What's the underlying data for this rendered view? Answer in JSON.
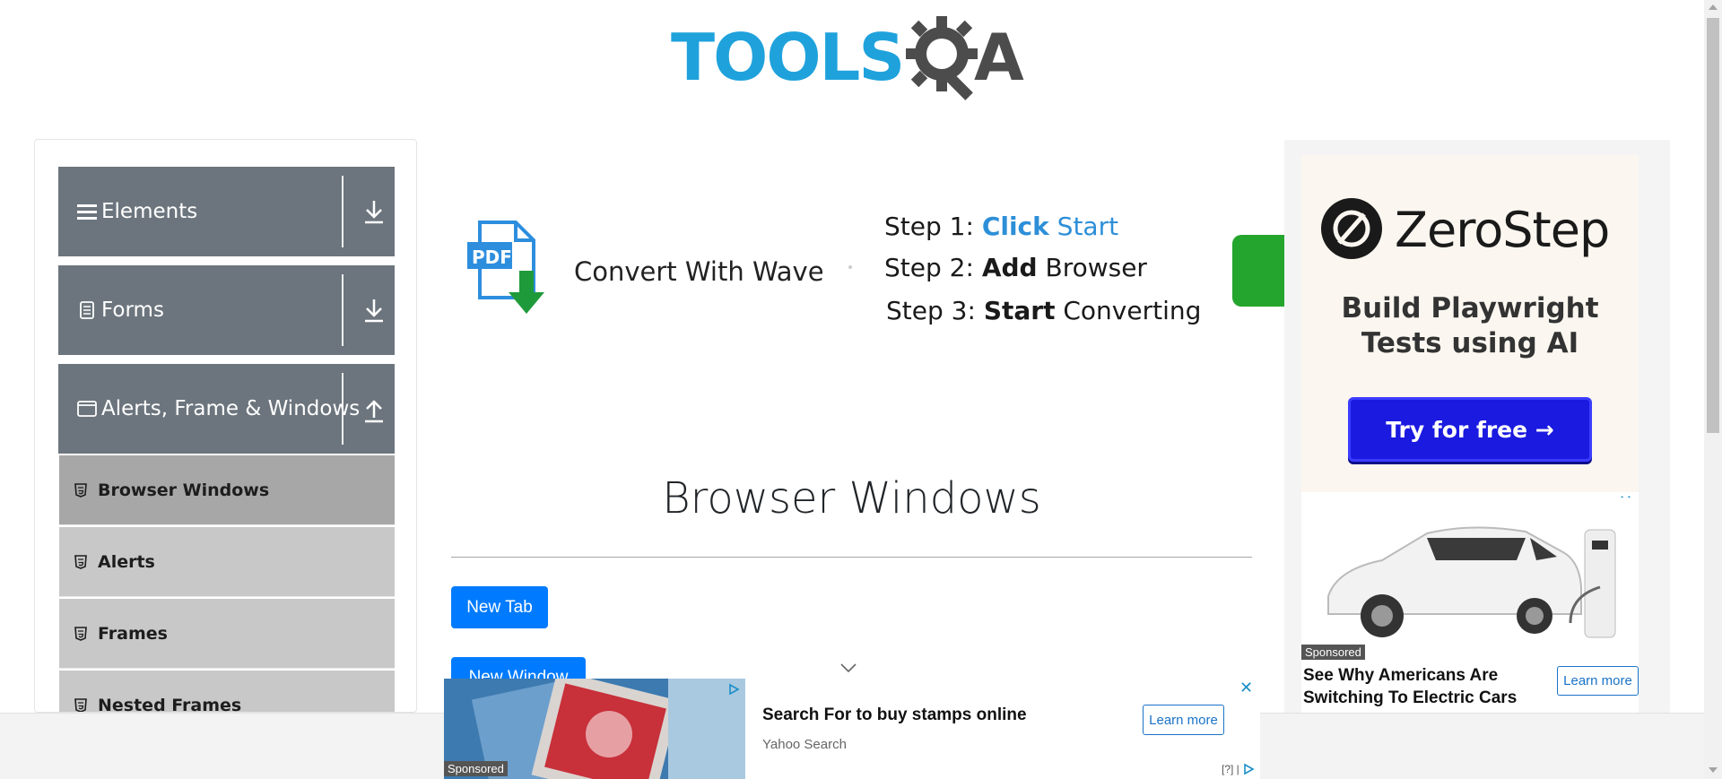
{
  "logo": {
    "text": "TOOLS",
    "suffix": "A"
  },
  "sidebar": {
    "groups": [
      {
        "label": "Elements",
        "icon": "hamburger-icon",
        "arrow": "download-arrow-icon"
      },
      {
        "label": "Forms",
        "icon": "document-icon",
        "arrow": "download-arrow-icon"
      },
      {
        "label": "Alerts, Frame & Windows",
        "icon": "window-icon",
        "arrow": "upload-arrow-icon"
      }
    ],
    "items": [
      {
        "label": "Browser Windows",
        "active": true
      },
      {
        "label": "Alerts"
      },
      {
        "label": "Frames"
      },
      {
        "label": "Nested Frames"
      }
    ]
  },
  "banner": {
    "title": "Convert With Wave",
    "step1_prefix": "Step 1: ",
    "step1_bold": "Click",
    "step1_rest": " Start",
    "step2_prefix": "Step 2: ",
    "step2_bold": "Add",
    "step2_rest": " Browser",
    "step3_prefix": "Step 3: ",
    "step3_bold": "Start",
    "step3_rest": " Converting",
    "pdf_label": "PDF"
  },
  "main": {
    "title": "Browser Windows",
    "new_tab": "New Tab",
    "new_window": "New Window"
  },
  "right_ad": {
    "brand": "ZeroStep",
    "tagline_1": "Build Playwright",
    "tagline_2": "Tests using AI",
    "cta": "Try for free →"
  },
  "car_ad": {
    "sponsored": "Sponsored",
    "headline": "See Why Americans Are Switching To Electric Cars",
    "cta": "Learn more",
    "close": "✕"
  },
  "bottom_ad": {
    "sponsored": "Sponsored",
    "headline": "Search For to buy stamps online",
    "source": "Yahoo Search",
    "cta": "Learn more",
    "close": "✕",
    "meta": "[?] |"
  }
}
